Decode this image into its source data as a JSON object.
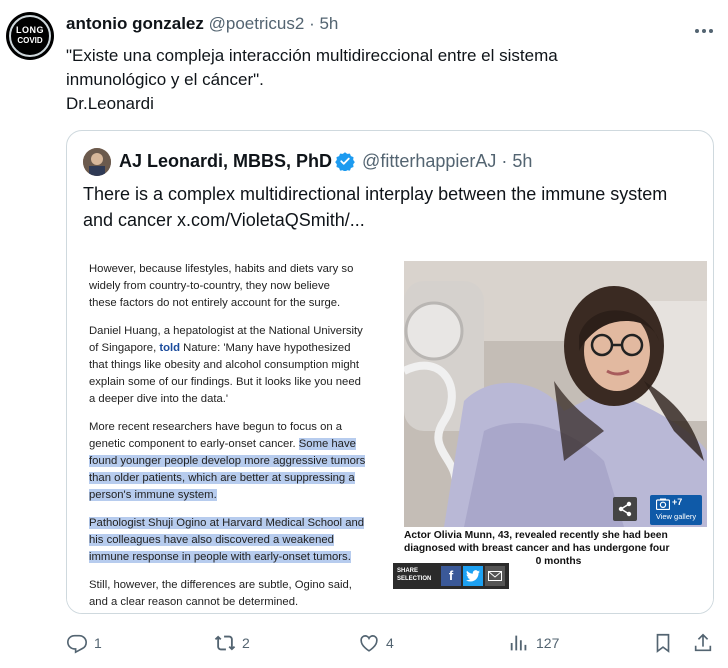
{
  "tweet": {
    "author_name": "antonio gonzalez",
    "author_handle": "@poetricus2",
    "separator": "·",
    "time": "5h",
    "more_icon": "more-horizontal-icon",
    "avatar_text_top": "LONG",
    "avatar_text_bottom": "COVID",
    "text_lines": [
      "\"Existe una compleja interacción multidireccional entre el sistema",
      "inmunológico y el cáncer\".",
      "Dr.Leonardi"
    ]
  },
  "quote": {
    "author_name": "AJ Leonardi, MBBS, PhD",
    "author_handle": "@fitterhappierAJ",
    "separator": "·",
    "time": "5h",
    "verified_color": "#1d9bf0",
    "text_lines": [
      "There is a complex multidirectional interplay between the immune system",
      "and cancer  x.com/VioletaQSmith/..."
    ]
  },
  "article": {
    "p1": [
      "However, because lifestyles, habits and diets vary so",
      "widely from country-to-country, they now believe",
      "these factors do not entirely account for the surge."
    ],
    "p2_line1": "Daniel Huang, a hepatologist at the National University",
    "p2_line2_a": "of Singapore, ",
    "p2_link": "told",
    "p2_line2_b": " Nature: 'Many have hypothesized",
    "p2_rest": [
      "that things like obesity and alcohol consumption might",
      "explain some of our findings. But it looks like you need",
      "a deeper dive into the data.'"
    ],
    "p3_line1": "More recent researchers have begun to focus on a",
    "p3_line2_a": "genetic component to early-onset cancer. ",
    "p3_line2_hl": "Some have",
    "p3_hl_lines": [
      "found younger people develop more aggressive tumors",
      "than older patients, which are better at suppressing a",
      "person's immune system."
    ],
    "p4_hl_lines": [
      "Pathologist Shuji Ogino at Harvard Medical School and",
      "his colleagues have also discovered a weakened",
      "immune response in people with early-onset tumors."
    ],
    "p5": [
      "Still, however, the differences are subtle, Ogino said,",
      "and a clear reason cannot be determined."
    ],
    "caption_lines": [
      "Actor Olivia Munn, 43, revealed recently she had been",
      "diagnosed with breast cancer and has undergone four",
      "                                              0 months"
    ],
    "share_selection_label_1": "SHARE",
    "share_selection_label_2": "SELECTION",
    "gallery_count": "+7",
    "gallery_label": "View gallery",
    "highlight_color": "#b7ccee"
  },
  "actions": {
    "reply_count": "1",
    "retweet_count": "2",
    "like_count": "4",
    "views_count": "127"
  }
}
